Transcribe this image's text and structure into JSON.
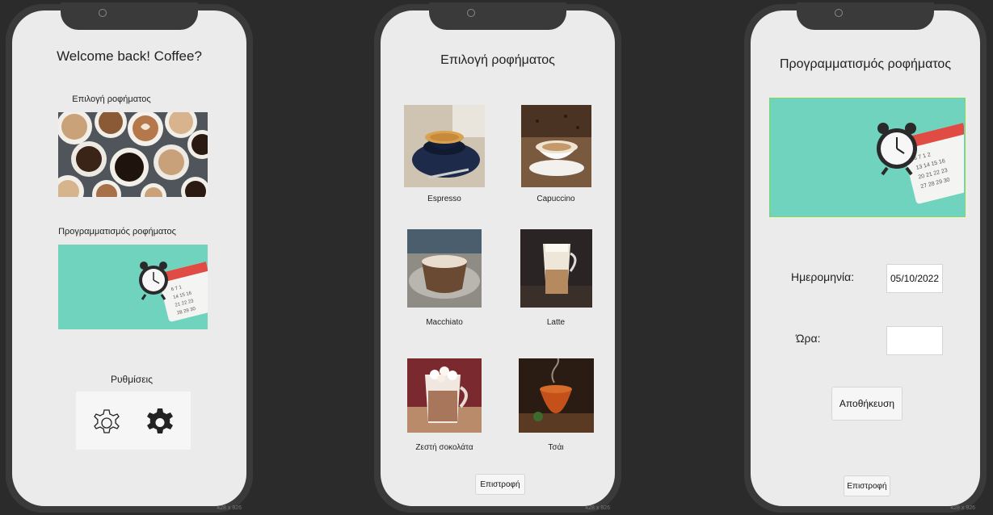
{
  "device_size_label": "428 x 926",
  "screen_home": {
    "title": "Welcome back! Coffee?",
    "choose_label": "Επιλογή ροφήματος",
    "schedule_label": "Προγραμματισμός ροφήματος",
    "settings_label": "Ρυθμίσεις",
    "settings_icons": [
      "gear-outline-icon",
      "gear-filled-icon"
    ]
  },
  "screen_choose": {
    "title": "Επιλογή ροφήματος",
    "drinks": [
      {
        "name": "Espresso"
      },
      {
        "name": "Capuccino"
      },
      {
        "name": "Macchiato"
      },
      {
        "name": "Latte"
      },
      {
        "name": "Ζεστή σοκολάτα"
      },
      {
        "name": "Τσάι"
      }
    ],
    "back_button": "Επιστροφή"
  },
  "screen_schedule": {
    "title": "Προγραμματισμός ροφήματος",
    "date_label": "Ημερομηνία:",
    "date_value": "05/10/2022",
    "time_label": "Ώρα:",
    "time_value": "",
    "save_button": "Αποθήκευση",
    "back_button": "Επιστροφή"
  },
  "colors": {
    "background": "#2b2b2b",
    "phone_frame": "#3a3a3a",
    "screen": "#ebebeb",
    "teal": "#6fd3be",
    "selection_border": "#7ed957"
  }
}
